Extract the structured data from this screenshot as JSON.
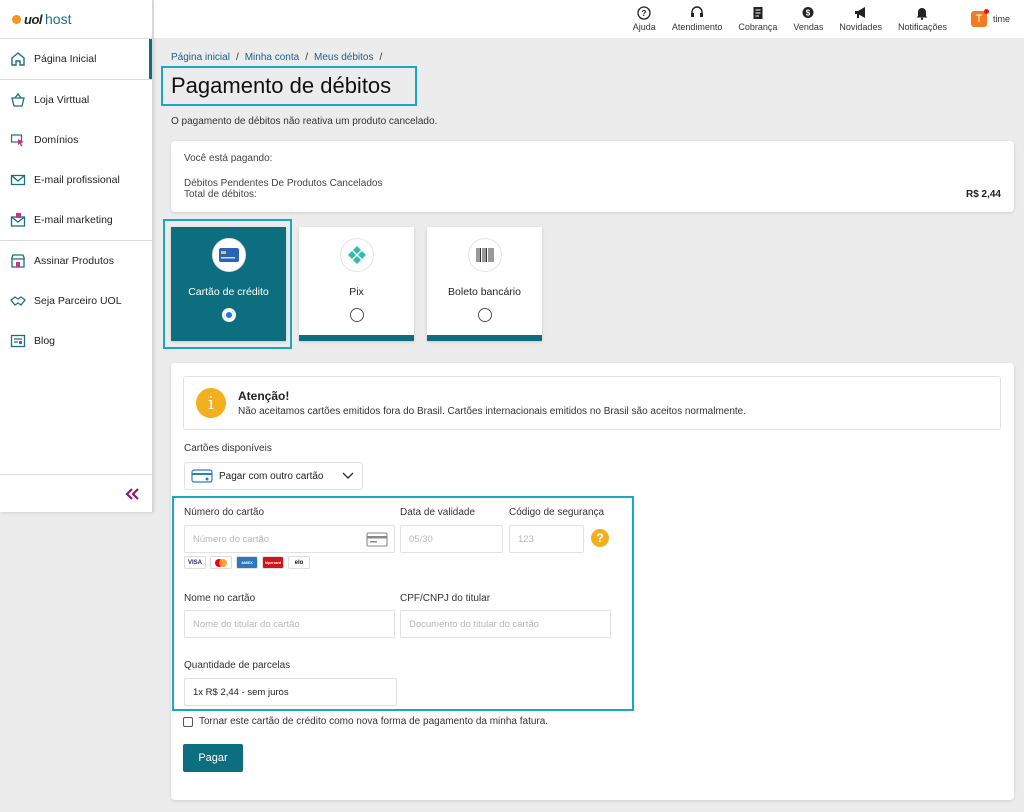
{
  "logo": {
    "uol": "uol",
    "host": "host"
  },
  "sidebar": {
    "items": [
      {
        "label": "Página Inicial"
      },
      {
        "label": "Loja Virttual"
      },
      {
        "label": "Domínios"
      },
      {
        "label": "E-mail profissional"
      },
      {
        "label": "E-mail marketing"
      },
      {
        "label": "Assinar Produtos"
      },
      {
        "label": "Seja Parceiro UOL"
      },
      {
        "label": "Blog"
      }
    ],
    "collapse_label": "«"
  },
  "topbar": {
    "items": [
      {
        "label": "Ajuda",
        "icon": "help-icon"
      },
      {
        "label": "Atendimento",
        "icon": "headset-icon"
      },
      {
        "label": "Cobrança",
        "icon": "invoice-icon"
      },
      {
        "label": "Vendas",
        "icon": "money-icon"
      },
      {
        "label": "Novidades",
        "icon": "megaphone-icon"
      },
      {
        "label": "Notificações",
        "icon": "bell-icon"
      }
    ],
    "user": {
      "initial": "T",
      "name": "time"
    }
  },
  "breadcrumb": [
    "Página inicial",
    "Minha conta",
    "Meus débitos"
  ],
  "page": {
    "title": "Pagamento de débitos",
    "subtitle": "O pagamento de débitos não reativa um produto cancelado."
  },
  "summary": {
    "heading": "Você está pagando:",
    "item": "Débitos Pendentes De Produtos Cancelados",
    "total_label": "Total de débitos:",
    "total_value": "R$ 2,44"
  },
  "payment_methods": [
    {
      "label": "Cartão de crédito",
      "selected": true
    },
    {
      "label": "Pix",
      "selected": false
    },
    {
      "label": "Boleto bancário",
      "selected": false
    }
  ],
  "alert": {
    "title": "Atenção!",
    "text": "Não aceitamos cartões emitidos fora do Brasil. Cartões internacionais emitidos no Brasil são aceitos normalmente.",
    "icon": "i"
  },
  "form": {
    "cards_label": "Cartões disponíveis",
    "cards_value": "Pagar com outro cartão",
    "card_number_label": "Número do cartão",
    "card_number_placeholder": "Número do cartão",
    "expiry_label": "Data de validade",
    "expiry_placeholder": "05/30",
    "cvv_label": "Código de segurança",
    "cvv_placeholder": "123",
    "cvv_help": "?",
    "name_label": "Nome no cartão",
    "name_placeholder": "Nome do titular do cartão",
    "doc_label": "CPF/CNPJ do titular",
    "doc_placeholder": "Documento do titular do cartão",
    "installments_label": "Quantidade de parcelas",
    "installments_value": "1x R$ 2,44 - sem juros",
    "brands": [
      "VISA",
      "mastercard",
      "AMEX",
      "hipercard",
      "elo"
    ],
    "save_card_label": "Tornar este cartão de crédito como nova forma de pagamento da minha fatura.",
    "pay_label": "Pagar"
  },
  "colors": {
    "accent": "#0d6e80",
    "highlight": "#19a6c9",
    "warning": "#f2b01e",
    "link": "#1b5f8c"
  }
}
